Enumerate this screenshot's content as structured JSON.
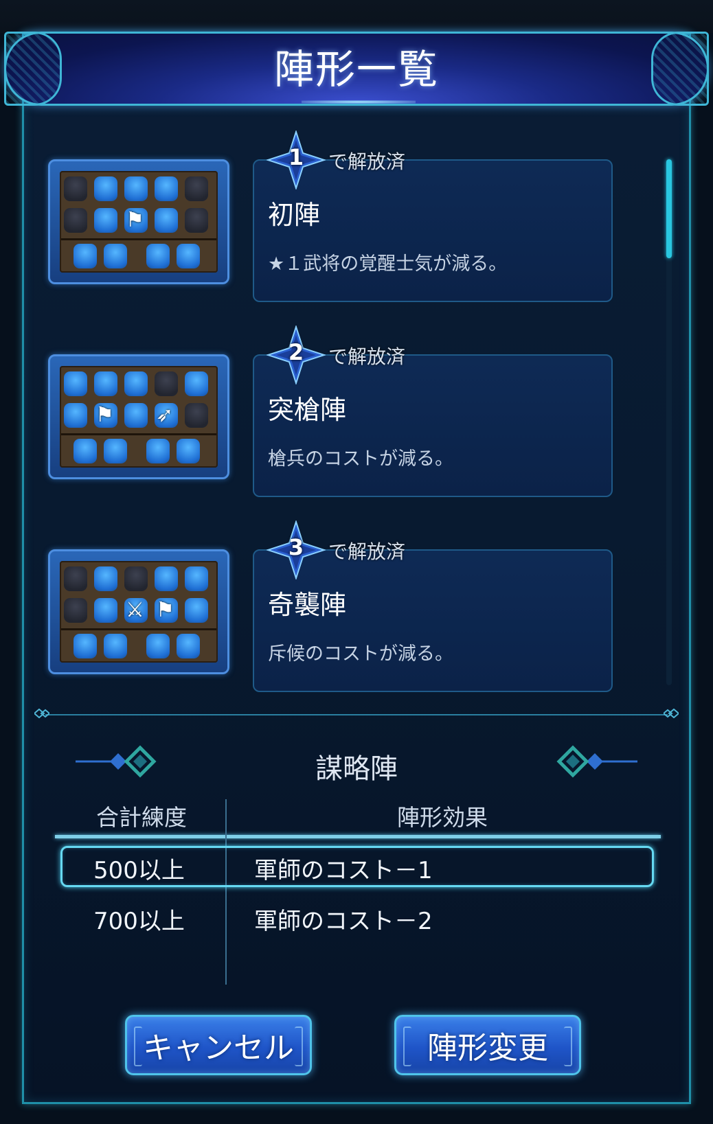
{
  "dialog": {
    "title": "陣形一覧",
    "unlock_suffix": "で解放済"
  },
  "formations": [
    {
      "level": "1",
      "name": "初陣",
      "description": "★１武将の覚醒士気が減る。"
    },
    {
      "level": "2",
      "name": "突槍陣",
      "description": "槍兵のコストが減る。"
    },
    {
      "level": "3",
      "name": "奇襲陣",
      "description": "斥候のコストが減る。"
    }
  ],
  "strategy_section": {
    "title": "謀略陣",
    "columns": {
      "total": "合計練度",
      "effect": "陣形効果"
    },
    "rows": [
      {
        "threshold": "500以上",
        "effect": "軍師のコスト－1"
      },
      {
        "threshold": "700以上",
        "effect": "軍師のコスト－2"
      }
    ]
  },
  "buttons": {
    "cancel": "キャンセル",
    "change": "陣形変更"
  },
  "colors": {
    "accent": "#3fb6d6",
    "button": "#1f55c8",
    "slot_blue": "#1f6fd4",
    "slot_dark": "#22252f"
  }
}
